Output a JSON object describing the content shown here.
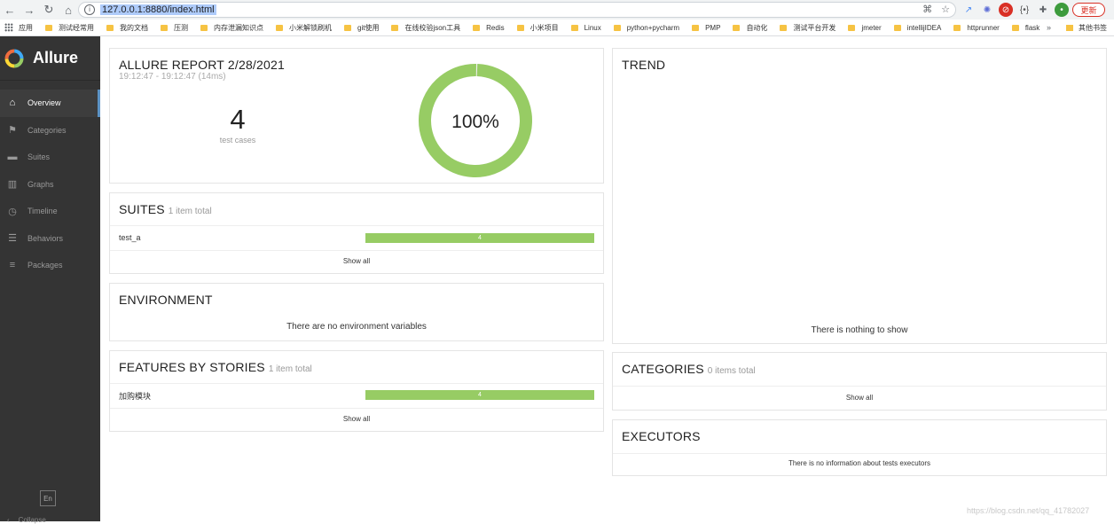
{
  "browser": {
    "url": "127.0.0.1:8880/index.html",
    "update_label": "更新",
    "bookmarks": [
      "应用",
      "测试经常用",
      "我的文档",
      "压测",
      "内存泄漏知识点",
      "小米解锁刷机",
      "git使用",
      "在线校验json工具",
      "Redis",
      "小米项目",
      "Linux",
      "python+pycharm",
      "PMP",
      "自动化",
      "测试平台开发",
      "jmeter",
      "intellijIDEA",
      "httprunner",
      "flask"
    ],
    "more_label": "»",
    "other_bookmarks": "其他书签"
  },
  "sidebar": {
    "brand": "Allure",
    "items": [
      {
        "label": "Overview",
        "icon": "home-icon"
      },
      {
        "label": "Categories",
        "icon": "flag-icon"
      },
      {
        "label": "Suites",
        "icon": "briefcase-icon"
      },
      {
        "label": "Graphs",
        "icon": "bar-chart-icon"
      },
      {
        "label": "Timeline",
        "icon": "clock-icon"
      },
      {
        "label": "Behaviors",
        "icon": "list-icon"
      },
      {
        "label": "Packages",
        "icon": "align-left-icon"
      }
    ],
    "language": "En",
    "collapse_label": "Collapse"
  },
  "summary": {
    "title": "ALLURE REPORT 2/28/2021",
    "time": "19:12:47 - 19:12:47 (14ms)",
    "count": "4",
    "count_label": "test cases",
    "percent": "100%",
    "pass_fraction": 1.0
  },
  "suites": {
    "title": "SUITES",
    "total": "1 item total",
    "rows": [
      {
        "name": "test_a",
        "value": "4"
      }
    ],
    "show_all": "Show all"
  },
  "environment": {
    "title": "ENVIRONMENT",
    "empty": "There are no environment variables"
  },
  "features": {
    "title": "FEATURES BY STORIES",
    "total": "1 item total",
    "rows": [
      {
        "name": "加购模块",
        "value": "4"
      }
    ],
    "show_all": "Show all"
  },
  "trend": {
    "title": "TREND",
    "empty": "There is nothing to show"
  },
  "categories": {
    "title": "CATEGORIES",
    "total": "0 items total",
    "show_all": "Show all"
  },
  "executors": {
    "title": "EXECUTORS",
    "empty": "There is no information about tests executors"
  },
  "colors": {
    "passed": "#97cc64",
    "sidebar_bg": "#343434",
    "accent": "#5c93c5"
  },
  "watermark": "https://blog.csdn.net/qq_41782027"
}
